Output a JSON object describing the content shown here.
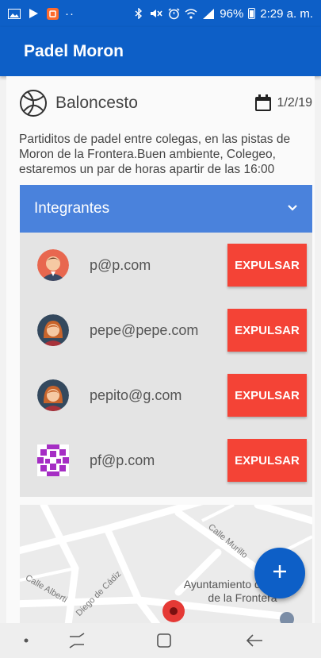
{
  "status_bar": {
    "battery": "96%",
    "time": "2:29 a. m.",
    "dots": "··"
  },
  "app_bar": {
    "title": "Padel Moron"
  },
  "event": {
    "sport": "Baloncesto",
    "date": "1/2/19",
    "description": "Partiditos de padel entre colegas, en las pistas de Moron de la Frontera.Buen ambiente, Colegeo, estaremos un par de horas apartir de las 16:00"
  },
  "members": {
    "title": "Integrantes",
    "kick_label": "EXPULSAR",
    "items": [
      {
        "email": "p@p.com",
        "avatar": "male-avatar-icon"
      },
      {
        "email": "pepe@pepe.com",
        "avatar": "female-avatar-icon"
      },
      {
        "email": "pepito@g.com",
        "avatar": "female-avatar-icon"
      },
      {
        "email": "pf@p.com",
        "avatar": "identicon-avatar-icon"
      }
    ]
  },
  "map": {
    "street_1": "Calle Murillo",
    "street_2": "Calle Alberti",
    "street_3": "Diego de Cádiz",
    "place": "Ayuntamiento de Morón de la Frontera"
  },
  "colors": {
    "primary": "#0d5fc7",
    "header": "#4a82dc",
    "danger": "#f44336"
  }
}
